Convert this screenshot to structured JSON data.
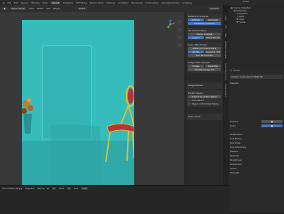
{
  "topbar": {
    "tabs": [
      "File",
      "Edit",
      "Render",
      "Window",
      "Help",
      "Layout",
      "Modeling",
      "UV Editing",
      "Texture Paint",
      "Shading",
      "Animation",
      "Rendering",
      "Compositing",
      "Geometry Nodes",
      "Scripting"
    ],
    "active_tab": "Layout",
    "scene_label": "Scene",
    "view_layer_label": "ViewLayer"
  },
  "header": {
    "mode": "Object Mode",
    "menus": [
      "View",
      "Select",
      "Add",
      "Object"
    ],
    "transform": "Global",
    "options_label": "Options"
  },
  "npanel": {
    "sections": [
      {
        "title": "Datablock Analysis",
        "buttons": [
          "Refresh",
          "Generate"
        ],
        "extra": "Datablock Compare"
      },
      {
        "title": "3D View Analysis",
        "buttons": [
          "Scene Analysis",
          "Layers"
        ],
        "extra": "Sheet Bonds"
      },
      {
        "title": "Scene Benchmark",
        "buttons": [
          "Reflection Benchmark",
          "UV Tile",
          "Inspector Slot"
        ],
        "extra": "Run Benchmark"
      },
      {
        "title": "Image Data Analysis",
        "buttons": [
          "Image",
          "Bone File"
        ],
        "extra": "Identify Image List"
      },
      {
        "title": "Image Reason",
        "buttons": [],
        "extra": ""
      },
      {
        "title": "Predict Space",
        "buttons": [
          "Search as option below",
          "Auto Select"
        ],
        "extra": "Object with Similar Name"
      },
      {
        "title": "Scene Tools",
        "buttons": [],
        "extra": ""
      }
    ]
  },
  "side_tabs": [
    "Item",
    "Tool",
    "View",
    "Datablock Analysis",
    "Scene Benchmark",
    "Image Reason"
  ],
  "outliner": {
    "header": "Scene",
    "items": [
      "Scene Collection",
      "Collection",
      "Camera",
      "Light",
      "Chair",
      "Frame"
    ]
  },
  "properties": {
    "scene_name": "Scene",
    "render_engine": "Modern Living Room HDRI 8K",
    "section": "Preview",
    "surface_label": "Surface",
    "color_label": "Color",
    "fields": [
      "Subsurface",
      "Sub Radius",
      "Sub Scale",
      "Sub Anisotropy",
      "Metallic",
      "Specular",
      "Roughness",
      "Anisotropic",
      "Sheen",
      "Strength"
    ]
  },
  "timeline": {
    "status_text": "hdri-unseen-4k.jpg",
    "frame": "1",
    "start_label": "Start",
    "start": "1",
    "end_label": "End",
    "end": "250",
    "keying_label": "Keying",
    "playback_label": "Playback"
  }
}
